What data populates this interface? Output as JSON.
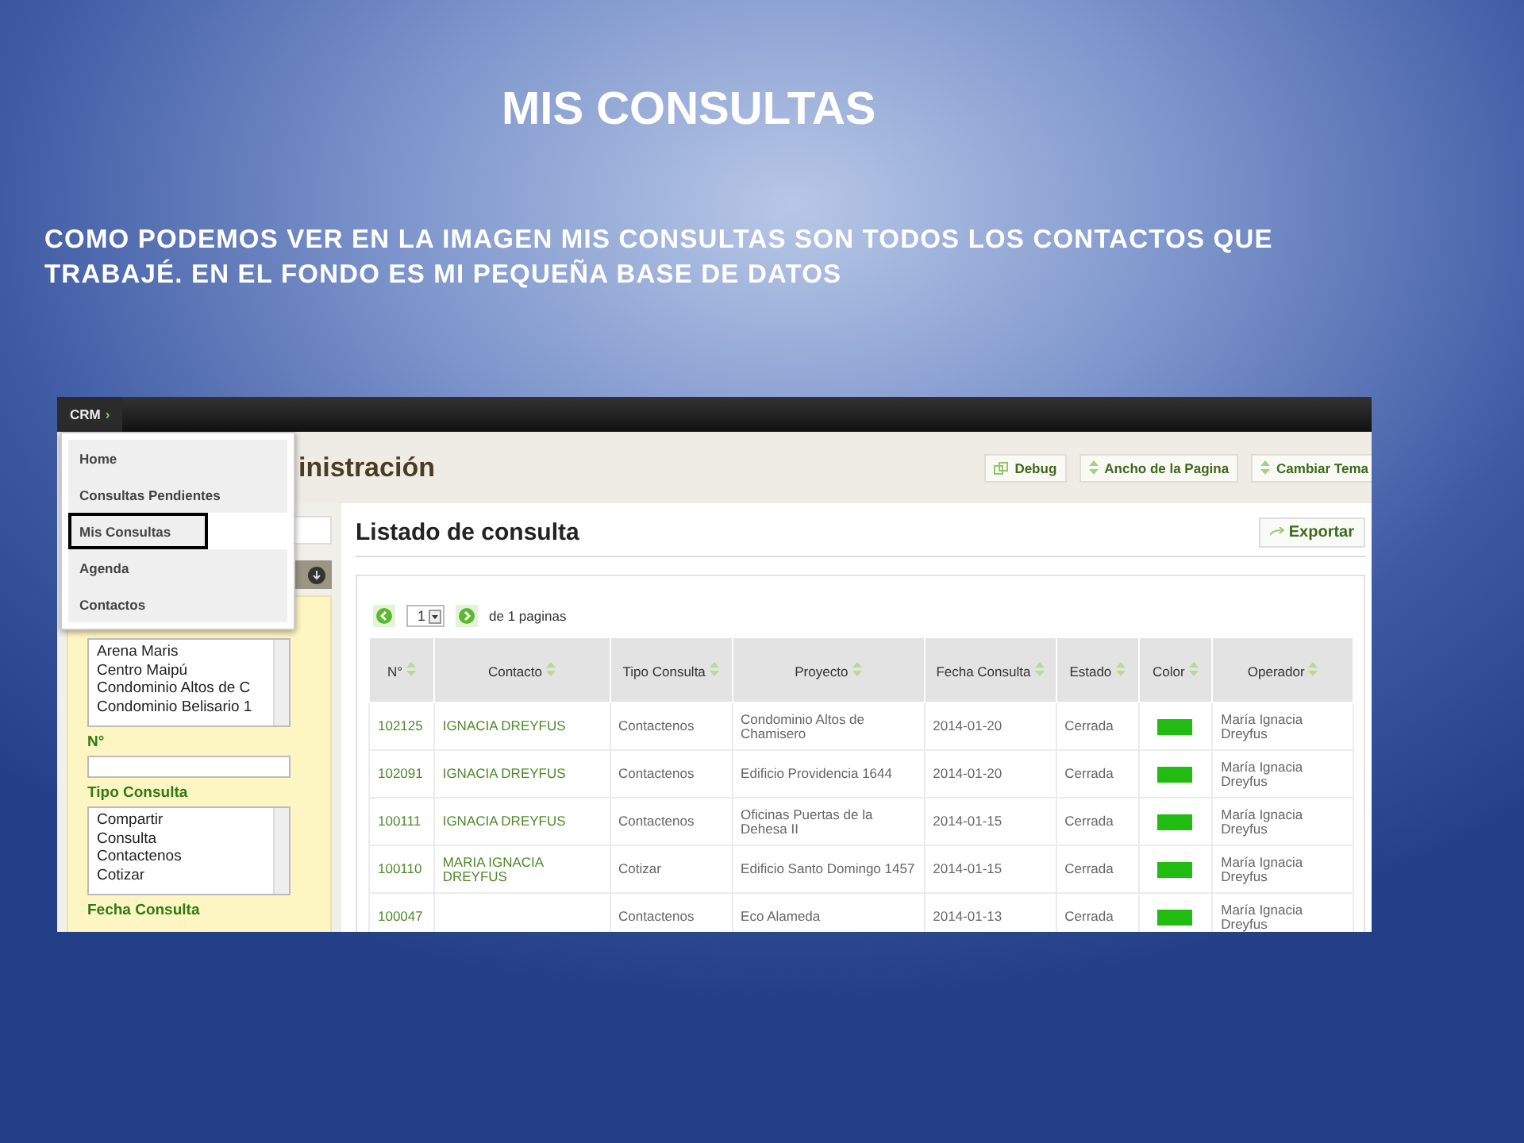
{
  "slide": {
    "title": "MIS CONSULTAS",
    "text": "COMO PODEMOS VER EN LA IMAGEN MIS CONSULTAS SON  TODOS LOS CONTACTOS QUE TRABAJÉ. EN EL FONDO ES MI PEQUEÑA BASE DE DATOS"
  },
  "app": {
    "brand": "CRM",
    "brand_caret": "›",
    "menu": [
      {
        "label": "Home",
        "selected": false
      },
      {
        "label": "Consultas Pendientes",
        "selected": false
      },
      {
        "label": "Mis Consultas",
        "selected": true
      },
      {
        "label": "Agenda",
        "selected": false
      },
      {
        "label": "Contactos",
        "selected": false
      }
    ],
    "header_title": "inistración",
    "header_buttons": [
      {
        "label": "Debug",
        "kind": "debug"
      },
      {
        "label": "Ancho de la Pagina",
        "kind": "toggle"
      },
      {
        "label": "Cambiar Tema",
        "kind": "toggle"
      }
    ],
    "sidebar": {
      "project_list": [
        "Arena Maris",
        "Centro Maipú",
        "Condominio Altos de C",
        "Condominio Belisario 1"
      ],
      "number_label": "N°",
      "type_label": "Tipo Consulta",
      "type_list": [
        "Compartir",
        "Consulta",
        "Contactenos",
        "Cotizar"
      ],
      "date_label": "Fecha Consulta"
    },
    "listing": {
      "title": "Listado de consulta",
      "export": "Exportar",
      "page": "1",
      "pages_text": "de 1  paginas",
      "columns": [
        "N°",
        "Contacto",
        "Tipo Consulta",
        "Proyecto",
        "Fecha Consulta",
        "Estado",
        "Color",
        "Operador"
      ],
      "rows": [
        {
          "number": "102125",
          "contact": "IGNACIA DREYFUS",
          "type": "Contactenos",
          "project": "Condominio Altos de Chamisero",
          "date": "2014-01-20",
          "status": "Cerrada",
          "color": "#22bb11",
          "operator": "María Ignacia Dreyfus"
        },
        {
          "number": "102091",
          "contact": "IGNACIA DREYFUS",
          "type": "Contactenos",
          "project": "Edificio Providencia 1644",
          "date": "2014-01-20",
          "status": "Cerrada",
          "color": "#22bb11",
          "operator": "María Ignacia Dreyfus"
        },
        {
          "number": "100111",
          "contact": "IGNACIA DREYFUS",
          "type": "Contactenos",
          "project": "Oficinas Puertas de la Dehesa II",
          "date": "2014-01-15",
          "status": "Cerrada",
          "color": "#22bb11",
          "operator": "María Ignacia Dreyfus"
        },
        {
          "number": "100110",
          "contact": "MARIA IGNACIA DREYFUS",
          "type": "Cotizar",
          "project": "Edificio Santo Domingo 1457",
          "date": "2014-01-15",
          "status": "Cerrada",
          "color": "#22bb11",
          "operator": "María Ignacia Dreyfus"
        },
        {
          "number": "100047",
          "type": "Contactenos",
          "project": "Eco Alameda",
          "date": "2014-01-13",
          "status": "Cerrada",
          "color": "#22bb11",
          "operator": "María Ignacia Dreyfus"
        }
      ]
    }
  }
}
